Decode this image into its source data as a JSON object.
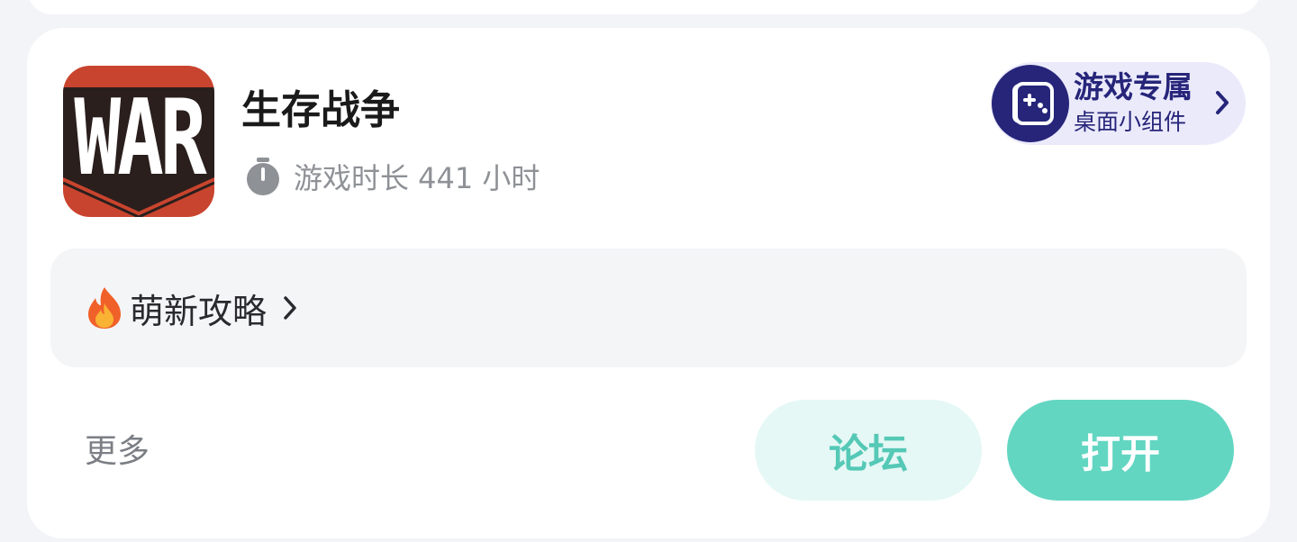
{
  "game": {
    "title": "生存战争",
    "icon": "war-game-logo",
    "icon_text": "WAR",
    "playtime_icon": "stopwatch-icon",
    "playtime_text": "游戏时长 441 小时"
  },
  "widget": {
    "title": "游戏专属",
    "subtitle": "桌面小组件",
    "icon": "gamepad-icon"
  },
  "guide": {
    "icon": "fire-icon",
    "label": "萌新攻略"
  },
  "footer": {
    "more_label": "更多",
    "forum_label": "论坛",
    "open_label": "打开"
  },
  "colors": {
    "accent": "#63d6c2",
    "accent_light": "#e5f8f5",
    "widget_bg": "#ebeafb",
    "widget_fg": "#26257a",
    "icon_red": "#c9442e",
    "icon_dark": "#2a1f1d"
  }
}
